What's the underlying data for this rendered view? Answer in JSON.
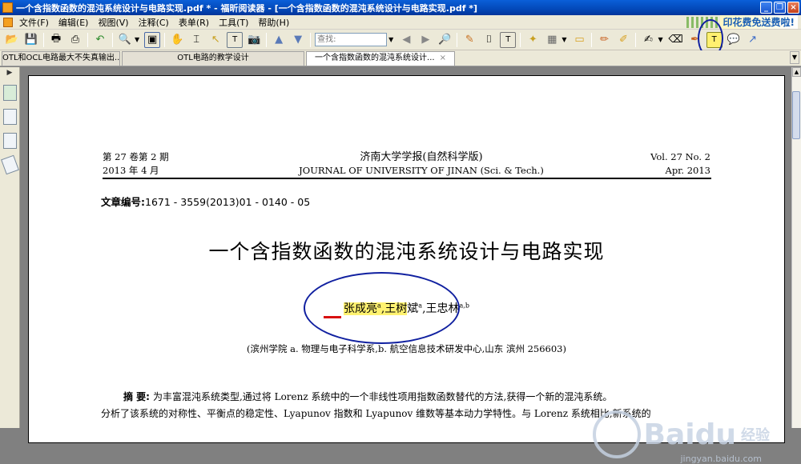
{
  "window": {
    "title": "一个含指数函数的混沌系统设计与电路实现.pdf * - 福昕阅读器 - [一个含指数函数的混沌系统设计与电路实现.pdf *]",
    "min": "_",
    "max": "❐",
    "close": "×"
  },
  "menu": {
    "items": [
      "文件(F)",
      "编辑(E)",
      "视图(V)",
      "注释(C)",
      "表单(R)",
      "工具(T)",
      "帮助(H)"
    ],
    "ad": "印花费免送费啦!"
  },
  "toolbar": {
    "search_placeholder": "查找:"
  },
  "tabs": [
    {
      "label": "OTL和OCL电路最大不失真输出..."
    },
    {
      "label": "OTL电路的教学设计"
    },
    {
      "label": "一个含指数函数的混沌系统设计...",
      "close": "×"
    }
  ],
  "document": {
    "header_left": [
      "第 27 卷第 2 期",
      "2013 年 4 月"
    ],
    "journal_cn": "济南大学学报(自然科学版)",
    "journal_en": "JOURNAL OF UNIVERSITY OF JINAN (Sci. & Tech.)",
    "header_right": [
      "Vol. 27 No. 2",
      "Apr. 2013"
    ],
    "article_no_label": "文章编号:",
    "article_no": "1671 - 3559(2013)01 - 0140 - 05",
    "title": "一个含指数函数的混沌系统设计与电路实现",
    "author1": "张成亮",
    "author1_sup": "a",
    "author_sep1": ",",
    "author2": "王树",
    "author2b": "斌",
    "author2_sup": "a",
    "author_sep2": ",",
    "author3": "王忠林",
    "author3_sup": "a,b",
    "affiliation": "(滨州学院  a. 物理与电子科学系,b. 航空信息技术研发中心,山东 滨州 256603)",
    "abstract_label": "摘    要:",
    "abstract_line1": "为丰富混沌系统类型,通过将 Lorenz 系统中的一个非线性项用指数函数替代的方法,获得一个新的混沌系统。",
    "abstract_line2": "分析了该系统的对称性、平衡点的稳定性、Lyapunov 指数和 Lyapunov 维数等基本动力学特性。与 Lorenz 系统相比,新系统的"
  },
  "watermark": {
    "brand": "Bai",
    "brand2": "du",
    "cn": "经验",
    "url": "jingyan.baidu.com"
  }
}
